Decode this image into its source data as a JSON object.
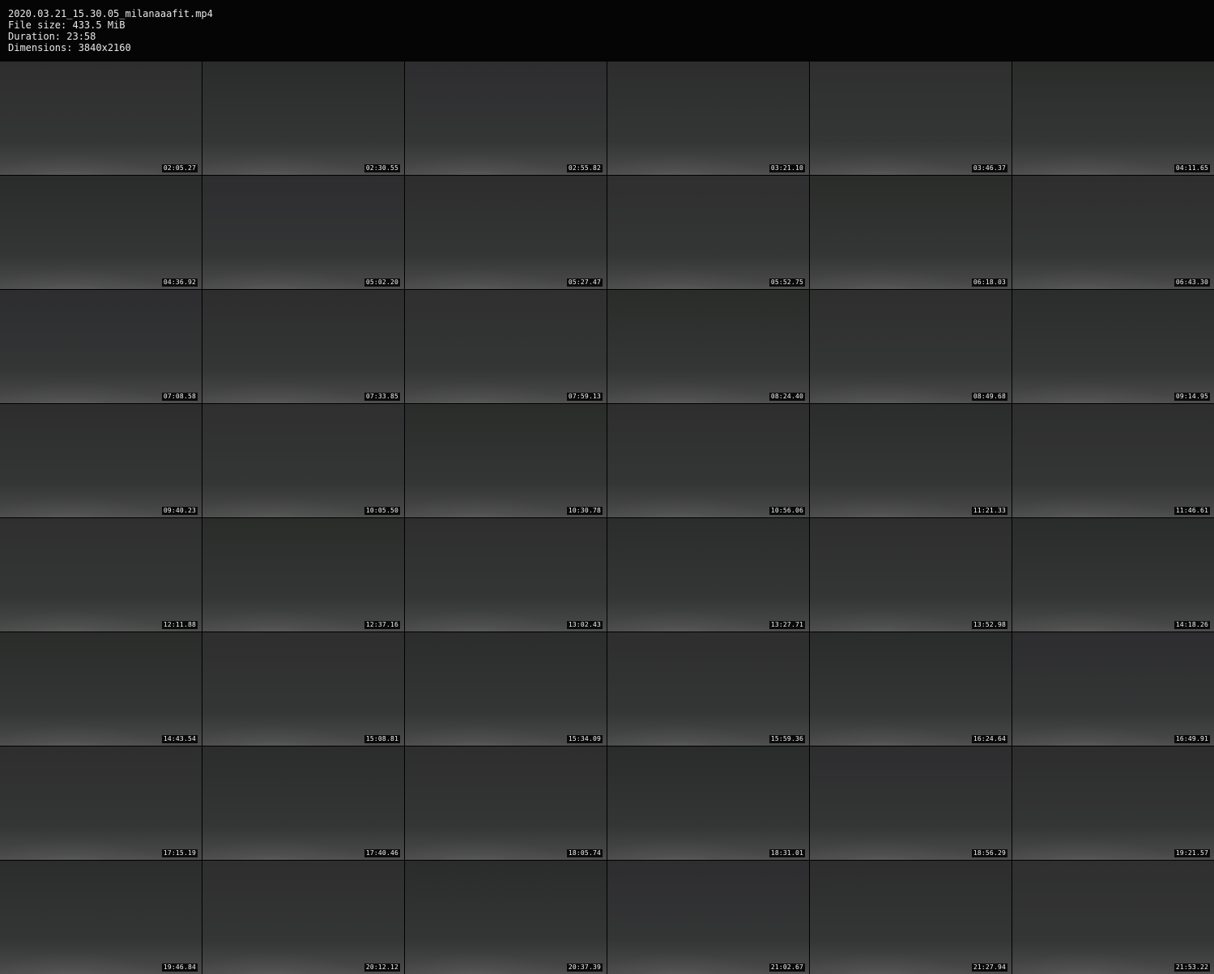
{
  "header": {
    "filename": "2020.03.21_15.30.05_milanaaafit.mp4",
    "file_size": "File size: 433.5 MiB",
    "duration": "Duration: 23:58",
    "dimensions": "Dimensions: 3840x2160"
  },
  "grid": {
    "columns": 6,
    "rows": 8,
    "thumbnails": [
      {
        "timestamp": "02:05.27"
      },
      {
        "timestamp": "02:30.55"
      },
      {
        "timestamp": "02:55.82"
      },
      {
        "timestamp": "03:21.10"
      },
      {
        "timestamp": "03:46.37"
      },
      {
        "timestamp": "04:11.65"
      },
      {
        "timestamp": "04:36.92"
      },
      {
        "timestamp": "05:02.20"
      },
      {
        "timestamp": "05:27.47"
      },
      {
        "timestamp": "05:52.75"
      },
      {
        "timestamp": "06:18.03"
      },
      {
        "timestamp": "06:43.30"
      },
      {
        "timestamp": "07:08.58"
      },
      {
        "timestamp": "07:33.85"
      },
      {
        "timestamp": "07:59.13"
      },
      {
        "timestamp": "08:24.40"
      },
      {
        "timestamp": "08:49.68"
      },
      {
        "timestamp": "09:14.95"
      },
      {
        "timestamp": "09:40.23"
      },
      {
        "timestamp": "10:05.50"
      },
      {
        "timestamp": "10:30.78"
      },
      {
        "timestamp": "10:56.06"
      },
      {
        "timestamp": "11:21.33"
      },
      {
        "timestamp": "11:46.61"
      },
      {
        "timestamp": "12:11.88"
      },
      {
        "timestamp": "12:37.16"
      },
      {
        "timestamp": "13:02.43"
      },
      {
        "timestamp": "13:27.71"
      },
      {
        "timestamp": "13:52.98"
      },
      {
        "timestamp": "14:18.26"
      },
      {
        "timestamp": "14:43.54"
      },
      {
        "timestamp": "15:08.81"
      },
      {
        "timestamp": "15:34.09"
      },
      {
        "timestamp": "15:59.36"
      },
      {
        "timestamp": "16:24.64"
      },
      {
        "timestamp": "16:49.91"
      },
      {
        "timestamp": "17:15.19"
      },
      {
        "timestamp": "17:40.46"
      },
      {
        "timestamp": "18:05.74"
      },
      {
        "timestamp": "18:31.01"
      },
      {
        "timestamp": "18:56.29"
      },
      {
        "timestamp": "19:21.57"
      },
      {
        "timestamp": "19:46.84"
      },
      {
        "timestamp": "20:12.12"
      },
      {
        "timestamp": "20:37.39"
      },
      {
        "timestamp": "21:02.67"
      },
      {
        "timestamp": "21:27.94"
      },
      {
        "timestamp": "21:53.22"
      }
    ]
  }
}
